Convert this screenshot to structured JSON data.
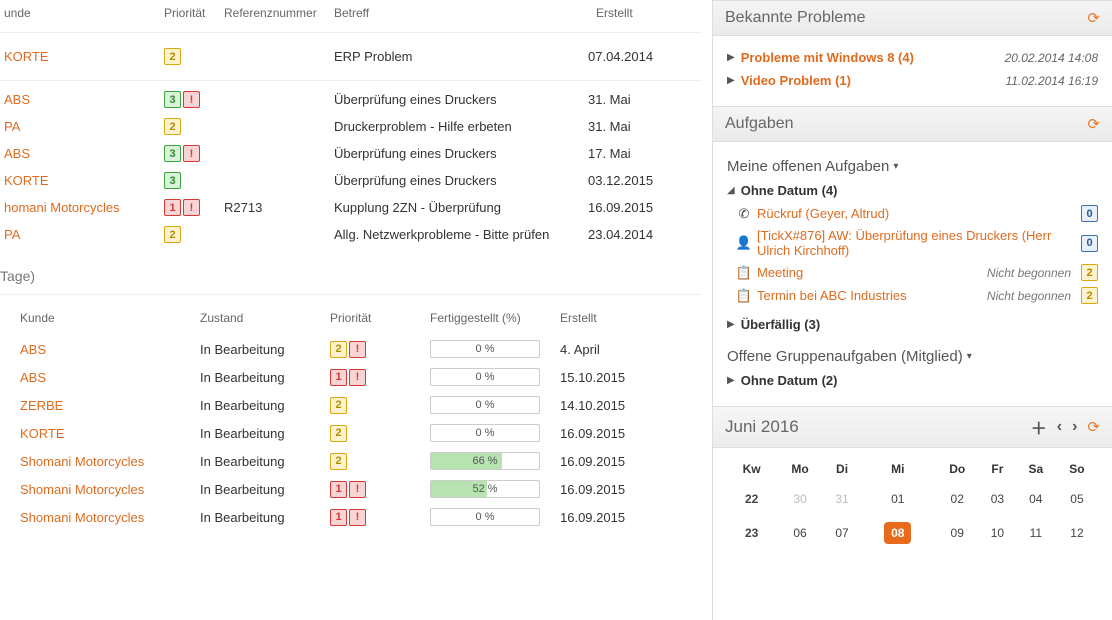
{
  "top_table": {
    "headers": {
      "kunde": "unde",
      "prio": "Priorität",
      "ref": "Referenznummer",
      "betreff": "Betreff",
      "erstellt": "Erstellt"
    },
    "group1": [
      {
        "kunde": "KORTE",
        "prio": "2",
        "alert": false,
        "ref": "",
        "betreff": "ERP Problem",
        "erstellt": "07.04.2014"
      }
    ],
    "group2": [
      {
        "kunde": "ABS",
        "prio": "3",
        "alert": true,
        "ref": "",
        "betreff": "Überprüfung eines Druckers",
        "erstellt": "31. Mai"
      },
      {
        "kunde": "PA",
        "prio": "2",
        "alert": false,
        "ref": "",
        "betreff": "Druckerproblem - Hilfe erbeten",
        "erstellt": "31. Mai"
      },
      {
        "kunde": "ABS",
        "prio": "3",
        "alert": true,
        "ref": "",
        "betreff": "Überprüfung eines Druckers",
        "erstellt": "17. Mai"
      },
      {
        "kunde": "KORTE",
        "prio": "3",
        "alert": false,
        "ref": "",
        "betreff": "Überprüfung eines Druckers",
        "erstellt": "03.12.2015"
      },
      {
        "kunde": "homani Motorcycles",
        "prio": "1",
        "alert": true,
        "ref": "R2713",
        "betreff": "Kupplung 2ZN - Überprüfung",
        "erstellt": "16.09.2015"
      },
      {
        "kunde": "PA",
        "prio": "2",
        "alert": false,
        "ref": "",
        "betreff": "Allg. Netzwerkprobleme - Bitte prüfen",
        "erstellt": "23.04.2014"
      }
    ]
  },
  "section2_title": "Tage)",
  "bottom_table": {
    "headers": {
      "kunde": "Kunde",
      "zustand": "Zustand",
      "prio": "Priorität",
      "fertig": "Fertiggestellt (%)",
      "erstellt": "Erstellt"
    },
    "rows": [
      {
        "kunde": "ABS",
        "zustand": "In Bearbeitung",
        "prio": "2",
        "alert": true,
        "pct": 0,
        "erstellt": "4. April"
      },
      {
        "kunde": "ABS",
        "zustand": "In Bearbeitung",
        "prio": "1",
        "alert": true,
        "pct": 0,
        "erstellt": "15.10.2015"
      },
      {
        "kunde": "ZERBE",
        "zustand": "In Bearbeitung",
        "prio": "2",
        "alert": false,
        "pct": 0,
        "erstellt": "14.10.2015"
      },
      {
        "kunde": "KORTE",
        "zustand": "In Bearbeitung",
        "prio": "2",
        "alert": false,
        "pct": 0,
        "erstellt": "16.09.2015"
      },
      {
        "kunde": "Shomani Motorcycles",
        "zustand": "In Bearbeitung",
        "prio": "2",
        "alert": false,
        "pct": 66,
        "erstellt": "16.09.2015"
      },
      {
        "kunde": "Shomani Motorcycles",
        "zustand": "In Bearbeitung",
        "prio": "1",
        "alert": true,
        "pct": 52,
        "erstellt": "16.09.2015"
      },
      {
        "kunde": "Shomani Motorcycles",
        "zustand": "In Bearbeitung",
        "prio": "1",
        "alert": true,
        "pct": 0,
        "erstellt": "16.09.2015"
      }
    ]
  },
  "right": {
    "problems": {
      "title": "Bekannte Probleme",
      "items": [
        {
          "label": "Probleme mit Windows 8 (4)",
          "ts": "20.02.2014 14:08"
        },
        {
          "label": "Video Problem (1)",
          "ts": "11.02.2014 16:19"
        }
      ]
    },
    "tasks": {
      "title": "Aufgaben",
      "mine_title": "Meine offenen Aufgaben",
      "no_date_label": "Ohne Datum (4)",
      "items": [
        {
          "icon": "phone",
          "label": "Rückruf (Geyer, Altrud)",
          "right_badge": "0"
        },
        {
          "icon": "person",
          "label": "[TickX#876] AW: Überprüfung eines Druckers (Herr Ulrich Kirchhoff)",
          "right_badge": "0"
        },
        {
          "icon": "clip",
          "label": "Meeting",
          "status": "Nicht begonnen",
          "right_badge": "2"
        },
        {
          "icon": "clip",
          "label": "Termin bei ABC Industries",
          "status": "Nicht begonnen",
          "right_badge": "2"
        }
      ],
      "overdue_label": "Überfällig (3)",
      "group_title": "Offene Gruppenaufgaben (Mitglied)",
      "group_no_date": "Ohne Datum (2)"
    },
    "calendar": {
      "title": "Juni 2016",
      "dow": [
        "Kw",
        "Mo",
        "Di",
        "Mi",
        "Do",
        "Fr",
        "Sa",
        "So"
      ],
      "rows": [
        {
          "kw": "22",
          "days": [
            {
              "d": "30",
              "dim": true
            },
            {
              "d": "31",
              "dim": true
            },
            {
              "d": "01"
            },
            {
              "d": "02"
            },
            {
              "d": "03"
            },
            {
              "d": "04"
            },
            {
              "d": "05"
            }
          ]
        },
        {
          "kw": "23",
          "days": [
            {
              "d": "06"
            },
            {
              "d": "07"
            },
            {
              "d": "08",
              "today": true
            },
            {
              "d": "09"
            },
            {
              "d": "10"
            },
            {
              "d": "11"
            },
            {
              "d": "12"
            }
          ]
        }
      ]
    }
  }
}
